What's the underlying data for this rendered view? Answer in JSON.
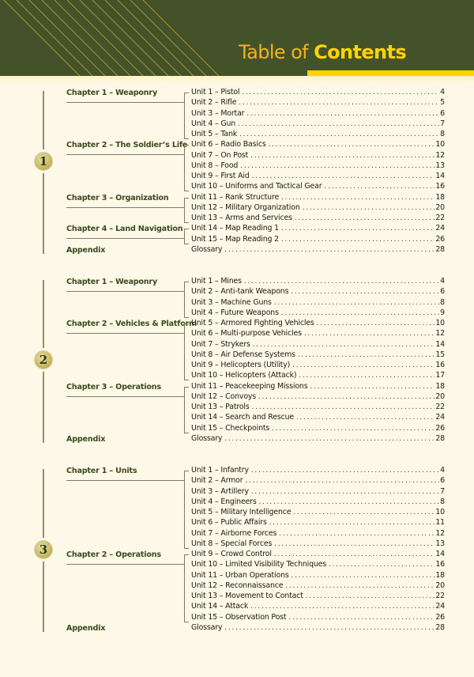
{
  "header": {
    "title_light": "Table of ",
    "title_bold": "Contents"
  },
  "colors": {
    "header_bg": "#44522a",
    "accent_yellow": "#ffd200",
    "title_orange": "#f0b31e",
    "page_bg": "#fdf8e7",
    "chapter_text": "#3a4a1e"
  },
  "sections": [
    {
      "badge": "1",
      "chapters": [
        {
          "label": "Chapter 1 – Weaponry",
          "units": [
            {
              "label": "Unit 1 – Pistol",
              "page": "4"
            },
            {
              "label": "Unit 2 – Rifle",
              "page": "5"
            },
            {
              "label": "Unit 3 – Mortar",
              "page": "6"
            },
            {
              "label": "Unit 4 – Gun",
              "page": "7"
            },
            {
              "label": "Unit 5 – Tank",
              "page": "8"
            }
          ]
        },
        {
          "label": "Chapter 2 – The Soldier’s Life",
          "units": [
            {
              "label": "Unit 6 – Radio Basics",
              "page": "10"
            },
            {
              "label": "Unit 7 – On Post",
              "page": "12"
            },
            {
              "label": "Unit 8 – Food",
              "page": "13"
            },
            {
              "label": "Unit 9 – First Aid",
              "page": "14"
            },
            {
              "label": "Unit 10 – Uniforms and Tactical Gear",
              "page": "16"
            }
          ]
        },
        {
          "label": "Chapter 3 – Organization",
          "units": [
            {
              "label": "Unit 11 – Rank Structure",
              "page": "18"
            },
            {
              "label": "Unit 12 – Military Organization",
              "page": "20"
            },
            {
              "label": "Unit 13 – Arms and Services",
              "page": "22"
            }
          ]
        },
        {
          "label": "Chapter 4 – Land Navigation",
          "units": [
            {
              "label": "Unit 14 – Map Reading 1",
              "page": "24"
            },
            {
              "label": "Unit 15 – Map Reading 2",
              "page": "26"
            }
          ]
        }
      ],
      "appendix": {
        "label": "Appendix",
        "entry": "Glossary",
        "page": "28"
      }
    },
    {
      "badge": "2",
      "chapters": [
        {
          "label": "Chapter 1 – Weaponry",
          "units": [
            {
              "label": "Unit 1 – Mines",
              "page": "4"
            },
            {
              "label": "Unit 2 – Anti-tank Weapons",
              "page": "6"
            },
            {
              "label": "Unit 3 – Machine Guns",
              "page": "8"
            },
            {
              "label": "Unit 4 – Future Weapons",
              "page": "9"
            }
          ]
        },
        {
          "label": "Chapter 2 – Vehicles & Platform",
          "units": [
            {
              "label": "Unit 5 – Armored Fighting Vehicles",
              "page": "10"
            },
            {
              "label": "Unit 6 – Multi-purpose Vehicles",
              "page": "12"
            },
            {
              "label": "Unit 7 – Strykers",
              "page": "14"
            },
            {
              "label": "Unit 8 – Air Defense Systems",
              "page": "15"
            },
            {
              "label": "Unit 9 – Helicopters (Utility)",
              "page": "16"
            },
            {
              "label": "Unit 10 – Helicopters (Attack)",
              "page": "17"
            }
          ]
        },
        {
          "label": "Chapter 3 – Operations",
          "units": [
            {
              "label": "Unit 11 – Peacekeeping Missions",
              "page": "18"
            },
            {
              "label": "Unit 12 – Convoys",
              "page": "20"
            },
            {
              "label": "Unit 13 – Patrols",
              "page": "22"
            },
            {
              "label": "Unit 14 – Search and Rescue",
              "page": "24"
            },
            {
              "label": "Unit 15 – Checkpoints",
              "page": "26"
            }
          ]
        }
      ],
      "appendix": {
        "label": "Appendix",
        "entry": "Glossary",
        "page": "28"
      }
    },
    {
      "badge": "3",
      "chapters": [
        {
          "label": "Chapter 1 – Units",
          "units": [
            {
              "label": "Unit 1 – Infantry",
              "page": "4"
            },
            {
              "label": "Unit 2 – Armor",
              "page": "6"
            },
            {
              "label": "Unit 3 – Artillery",
              "page": "7"
            },
            {
              "label": "Unit 4 – Engineers",
              "page": "8"
            },
            {
              "label": "Unit 5 – Military Intelligence",
              "page": "10"
            },
            {
              "label": "Unit 6 – Public Affairs",
              "page": "11"
            },
            {
              "label": "Unit 7 – Airborne Forces",
              "page": "12"
            },
            {
              "label": "Unit 8 – Special Forces",
              "page": "13"
            }
          ]
        },
        {
          "label": "Chapter 2 – Operations",
          "units": [
            {
              "label": "Unit 9 – Crowd Control",
              "page": "14"
            },
            {
              "label": "Unit 10 – Limited Visibility Techniques",
              "page": "16"
            },
            {
              "label": "Unit 11 – Urban Operations",
              "page": "18"
            },
            {
              "label": "Unit 12 – Reconnaissance",
              "page": "20"
            },
            {
              "label": "Unit 13 – Movement to Contact",
              "page": "22"
            },
            {
              "label": "Unit 14 – Attack",
              "page": "24"
            },
            {
              "label": "Unit 15 – Observation Post",
              "page": "26"
            }
          ]
        }
      ],
      "appendix": {
        "label": "Appendix",
        "entry": "Glossary",
        "page": "28"
      }
    }
  ]
}
